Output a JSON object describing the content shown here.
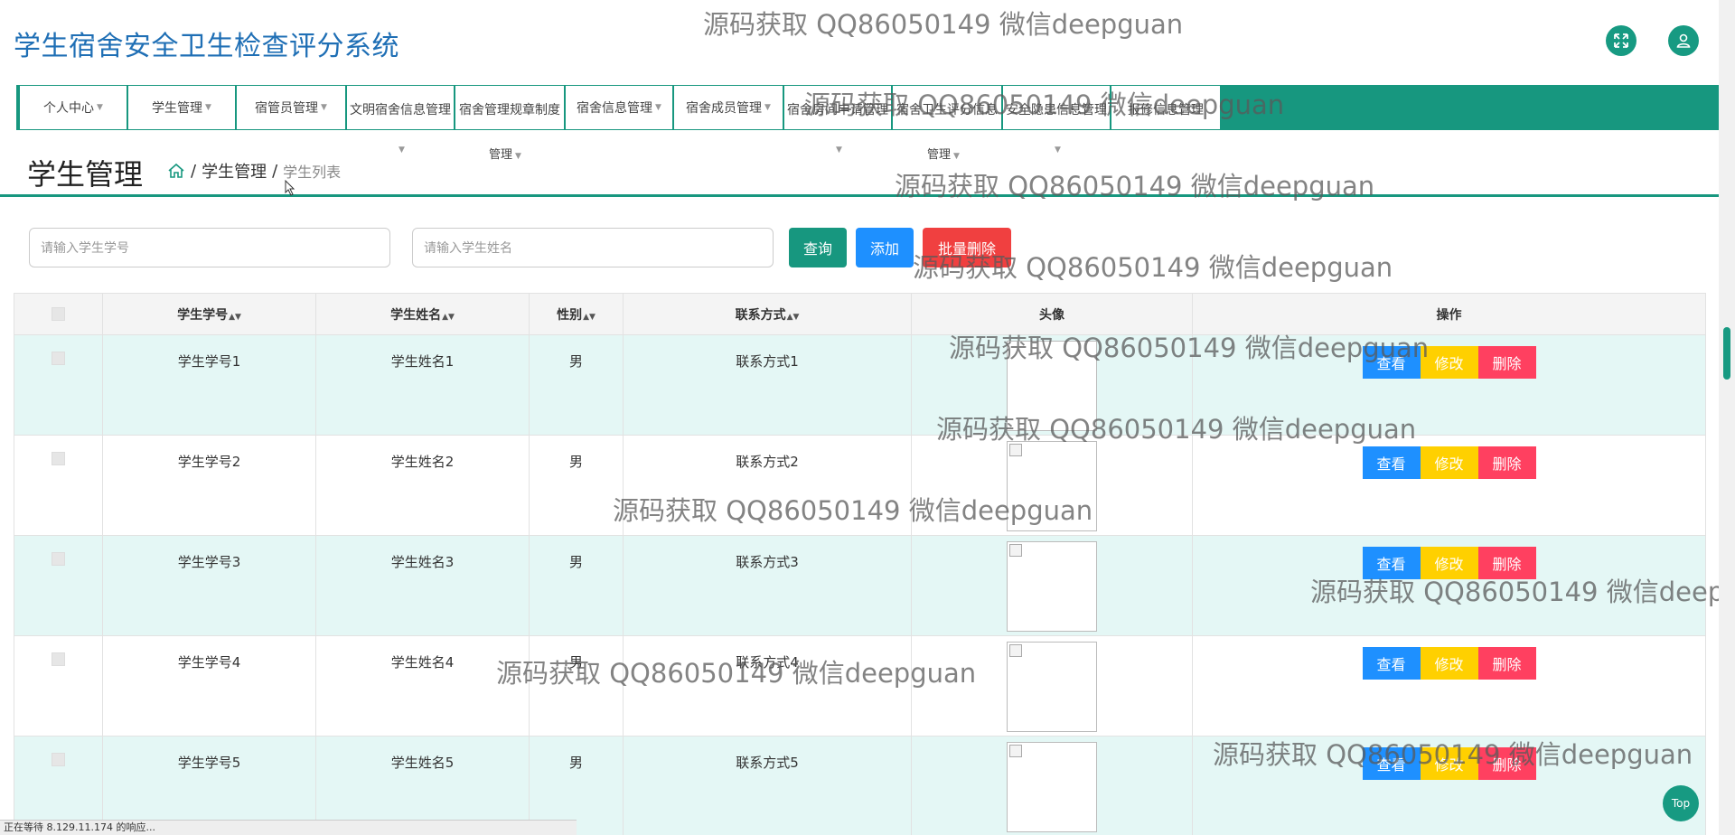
{
  "app": {
    "title": "学生宿舍安全卫生检查评分系统"
  },
  "header": {
    "fullscreen_icon": "expand-arrows-icon",
    "user_icon": "user-icon"
  },
  "nav": {
    "items": [
      {
        "label": "个人中心"
      },
      {
        "label": "学生管理"
      },
      {
        "label": "宿管员管理"
      },
      {
        "label": "文明宿舍信息管理"
      },
      {
        "label": "宿舍管理规章制度"
      },
      {
        "label": "宿舍信息管理"
      },
      {
        "label": "宿舍成员管理"
      },
      {
        "label": "宿舍房间申请管理"
      },
      {
        "label": "宿舍卫生评分信息"
      },
      {
        "label": "安全隐患信息管理"
      },
      {
        "label": "报修信息管理"
      }
    ],
    "subline_label": "管理"
  },
  "breadcrumb": {
    "heading": "学生管理",
    "home_icon": "home-icon",
    "separator": "/",
    "level1": "学生管理",
    "level2": "学生列表"
  },
  "search": {
    "xuehao_placeholder": "请输入学生学号",
    "name_placeholder": "请输入学生姓名",
    "query_label": "查询",
    "add_label": "添加",
    "batch_delete_label": "批量删除"
  },
  "table": {
    "headers": {
      "xuehao": "学生学号",
      "name": "学生姓名",
      "gender": "性别",
      "contact": "联系方式",
      "avatar": "头像",
      "ops": "操作"
    },
    "sort_icon": "sort-icon",
    "rows": [
      {
        "xuehao": "学生学号1",
        "name": "学生姓名1",
        "gender": "男",
        "contact": "联系方式1"
      },
      {
        "xuehao": "学生学号2",
        "name": "学生姓名2",
        "gender": "男",
        "contact": "联系方式2"
      },
      {
        "xuehao": "学生学号3",
        "name": "学生姓名3",
        "gender": "男",
        "contact": "联系方式3"
      },
      {
        "xuehao": "学生学号4",
        "name": "学生姓名4",
        "gender": "男",
        "contact": "联系方式4"
      },
      {
        "xuehao": "学生学号5",
        "name": "学生姓名5",
        "gender": "男",
        "contact": "联系方式5"
      }
    ],
    "actions": {
      "view": "查看",
      "edit": "修改",
      "delete": "删除"
    }
  },
  "watermark": {
    "text": "源码获取 QQ86050149 微信deepguan",
    "text_cut": "源码获取 QQ86050149 微信deep"
  },
  "status_bar": {
    "text": "正在等待 8.129.11.174 的响应..."
  },
  "top_button": {
    "label": "Top"
  },
  "colors": {
    "primary": "#17977f",
    "title": "#1f6fb5",
    "query": "#17977f",
    "add": "#1e90ff",
    "batch_delete": "#f04040",
    "view": "#1e90ff",
    "edit": "#ffd000",
    "delete": "#ff4060",
    "row_alt": "#e4f7f5"
  }
}
